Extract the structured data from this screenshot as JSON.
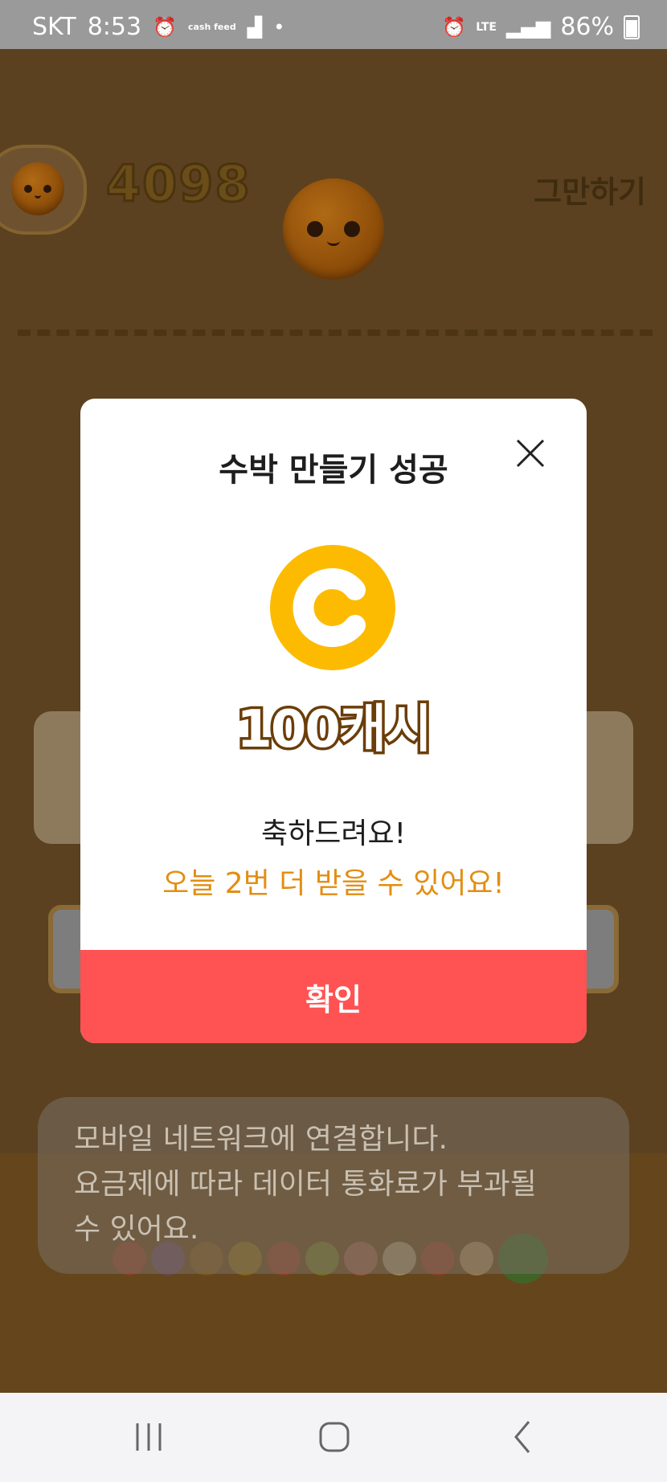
{
  "status_bar": {
    "carrier": "SKT",
    "time": "8:53",
    "left_icons": [
      "alarm-icon",
      "cashfeed-icon",
      "app-icon",
      "dot-icon"
    ],
    "cashfeed_label": "cash feed",
    "network": "LTE",
    "battery": "86%"
  },
  "game": {
    "score": "4098",
    "stop_label": "그만하기"
  },
  "modal": {
    "title": "수박 만들기 성공",
    "reward_icon": "cash-coin-icon",
    "reward_text": "100캐시",
    "congrats": "축하드려요!",
    "remaining": "오늘 2번 더 받을 수 있어요!",
    "confirm_label": "확인",
    "colors": {
      "coin": "#fcbb00",
      "confirm": "#ff5252",
      "remaining_text": "#e38e12"
    }
  },
  "toast": {
    "line1": "모바일 네트워크에 연결합니다.",
    "line2": "요금제에 따라 데이터 통화료가 부과될",
    "line3": "수 있어요."
  },
  "nav": {
    "items": [
      "recent-apps-icon",
      "home-icon",
      "back-icon"
    ]
  }
}
